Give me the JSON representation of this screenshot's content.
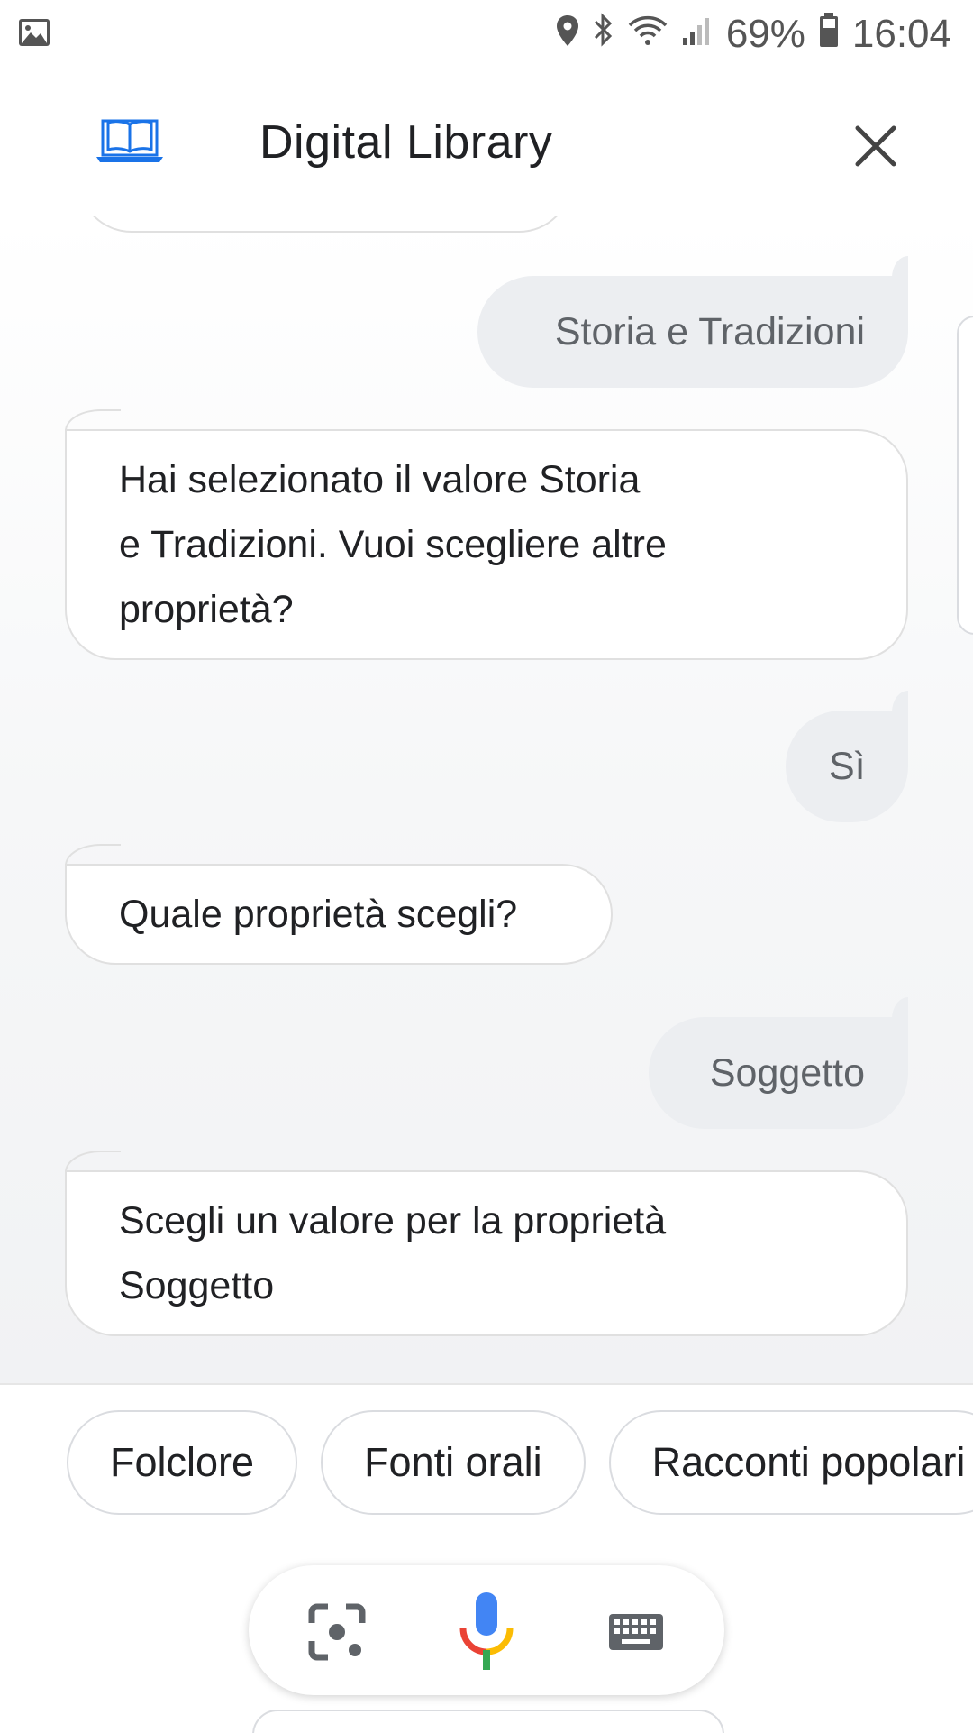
{
  "status_bar": {
    "battery": "69%",
    "time": "16:04",
    "icons": [
      "gallery-icon",
      "location-icon",
      "bluetooth-icon",
      "wifi-icon",
      "signal-icon",
      "battery-icon"
    ]
  },
  "header": {
    "title": "Digital Library",
    "logo_icon": "book-laptop-icon",
    "close_icon": "close-icon"
  },
  "chat": {
    "messages": [
      {
        "role": "user",
        "text": "Storia e Tradizioni"
      },
      {
        "role": "bot",
        "lines": [
          "Hai selezionato il valore Storia",
          "e Tradizioni. Vuoi scegliere altre",
          "proprietà?"
        ]
      },
      {
        "role": "user",
        "text": "Sì"
      },
      {
        "role": "bot",
        "lines": [
          "Quale proprietà scegli?"
        ]
      },
      {
        "role": "user",
        "text": "Soggetto"
      },
      {
        "role": "bot",
        "lines": [
          "Scegli un valore per la proprietà",
          "Soggetto"
        ]
      }
    ]
  },
  "suggestions": [
    "Folclore",
    "Fonti orali",
    "Racconti popolari"
  ],
  "input_bar": {
    "lens_icon": "lens-icon",
    "mic_icon": "microphone-icon",
    "keyboard_icon": "keyboard-icon"
  },
  "colors": {
    "user_bubble": "#eceef1",
    "bot_border": "#e0e0e0",
    "logo_blue": "#1a73e8",
    "mic_blue": "#4285f4",
    "mic_red": "#ea4335",
    "mic_yellow": "#fbbc04",
    "mic_green": "#34a853"
  }
}
